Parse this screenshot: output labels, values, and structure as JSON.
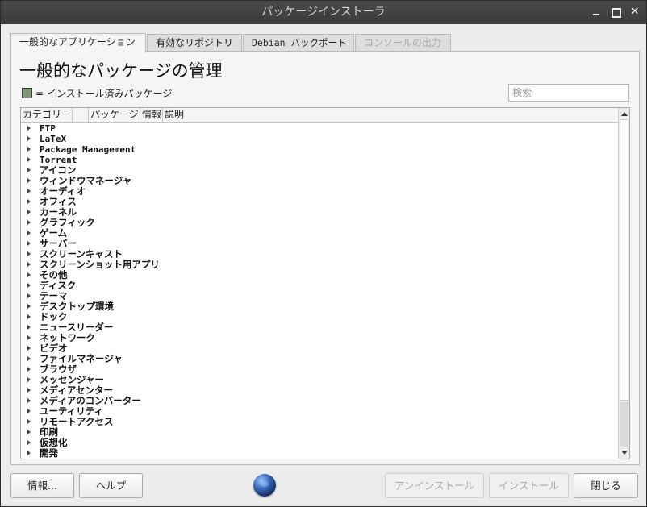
{
  "window": {
    "title": "パッケージインストーラ"
  },
  "tabs": [
    {
      "label": "一般的なアプリケーション"
    },
    {
      "label": "有効なリポジトリ"
    },
    {
      "label": "Debian バックポート"
    },
    {
      "label": "コンソールの出力"
    }
  ],
  "main": {
    "heading": "一般的なパッケージの管理",
    "legend_text": "= インストール済みパッケージ",
    "legend_color": "#7e9878",
    "search_placeholder": "検索"
  },
  "tree": {
    "columns": [
      "カテゴリー",
      "",
      "パッケージ",
      "情報",
      "説明"
    ],
    "categories": [
      "FTP",
      "LaTeX",
      "Package Management",
      "Torrent",
      "アイコン",
      "ウィンドウマネージャ",
      "オーディオ",
      "オフィス",
      "カーネル",
      "グラフィック",
      "ゲーム",
      "サーバー",
      "スクリーンキャスト",
      "スクリーンショット用アプリ",
      "その他",
      "ディスク",
      "テーマ",
      "デスクトップ環境",
      "ドック",
      "ニュースリーダー",
      "ネットワーク",
      "ビデオ",
      "ファイルマネージャ",
      "ブラウザ",
      "メッセンジャー",
      "メディアセンター",
      "メディアのコンバーター",
      "ユーティリティ",
      "リモートアクセス",
      "印刷",
      "仮想化",
      "開発"
    ]
  },
  "buttons": {
    "info": "情報...",
    "help": "ヘルプ",
    "uninstall": "アンインストール",
    "install": "インストール",
    "close": "閉じる"
  }
}
